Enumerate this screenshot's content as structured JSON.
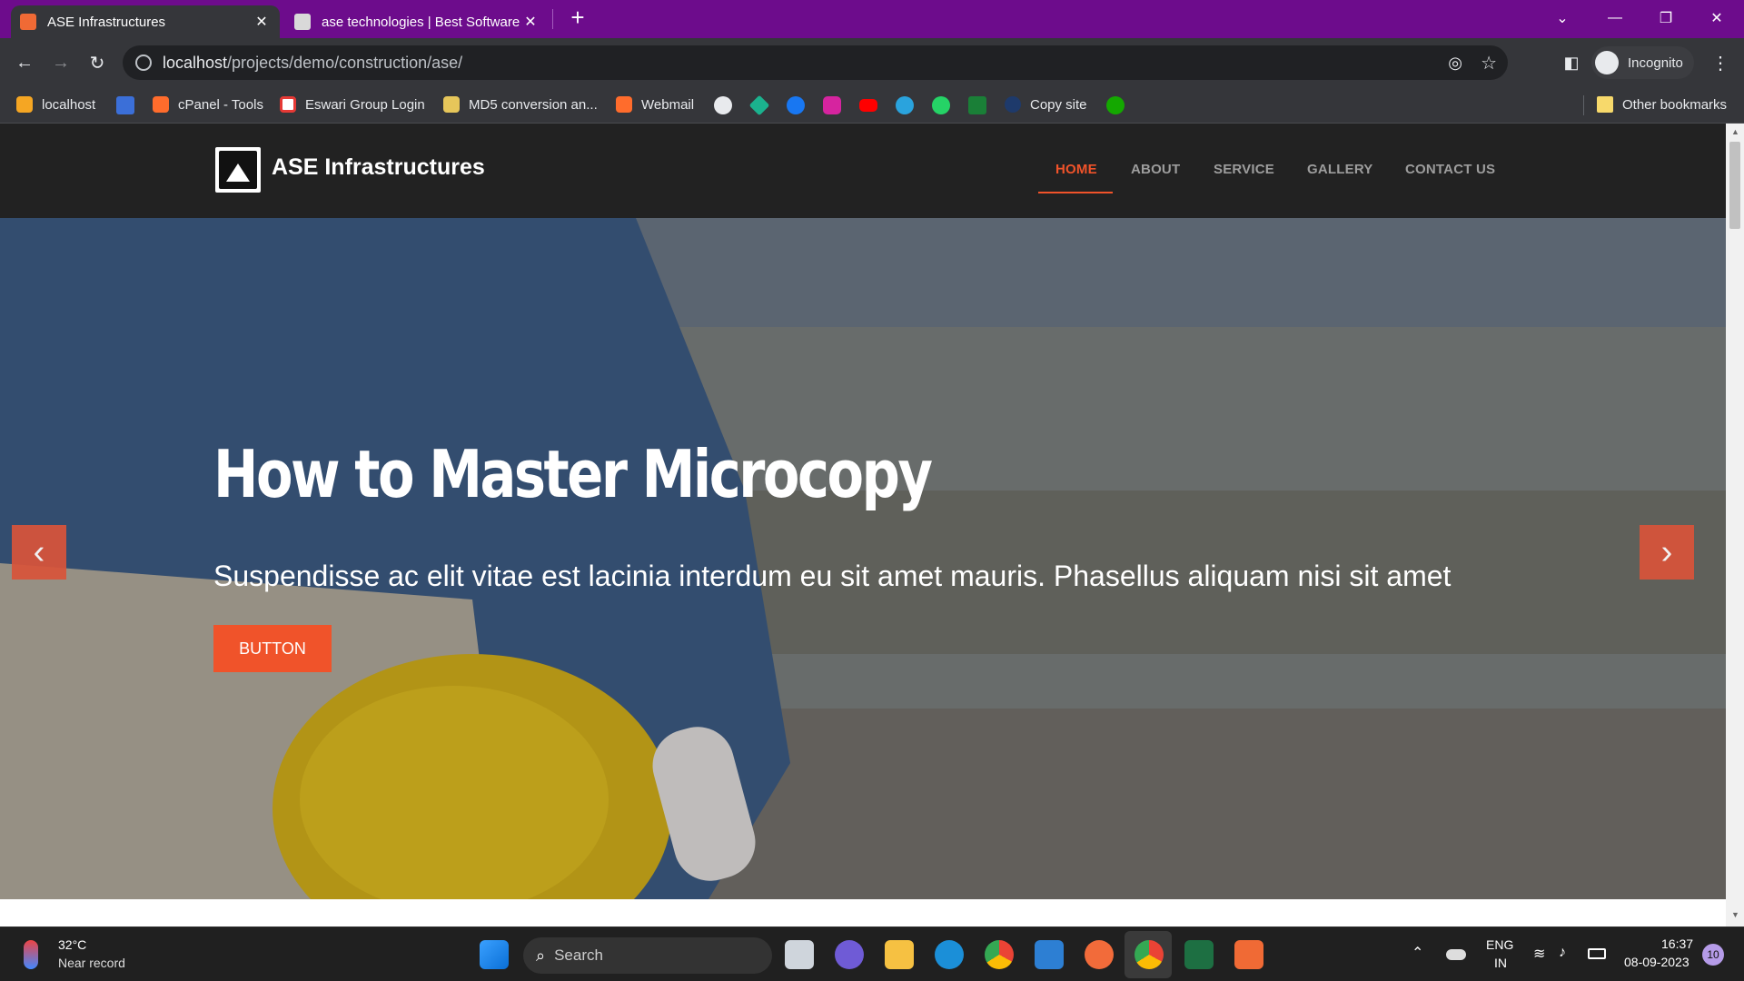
{
  "browser": {
    "tabs": [
      {
        "title": "ASE Infrastructures",
        "active": true
      },
      {
        "title": "ase technologies | Best Software",
        "active": false
      }
    ],
    "new_tab": "+",
    "url_host": "localhost",
    "url_path": "/projects/demo/construction/ase/",
    "profile": "Incognito",
    "bookmarks": [
      "localhost",
      "cPanel - Tools",
      "Eswari Group Login",
      "MD5 conversion an...",
      "Webmail",
      "Copy site"
    ],
    "other_bookmarks": "Other bookmarks"
  },
  "site": {
    "brand": "ASE Infrastructures",
    "nav": [
      "HOME",
      "ABOUT",
      "SERVICE",
      "GALLERY",
      "CONTACT US"
    ],
    "active_nav": "HOME",
    "hero": {
      "title": "How to Master Microcopy",
      "subtitle": "Suspendisse ac elit vitae est lacinia interdum eu sit amet mauris. Phasellus aliquam nisi sit amet",
      "button": "BUTTON",
      "prev": "‹",
      "next": "›"
    },
    "accent_color": "#f0532a"
  },
  "taskbar": {
    "weather_temp": "32°C",
    "weather_desc": "Near record",
    "search": "Search",
    "lang_1": "ENG",
    "lang_2": "IN",
    "time": "16:37",
    "date": "08-09-2023",
    "notifications": "10"
  }
}
